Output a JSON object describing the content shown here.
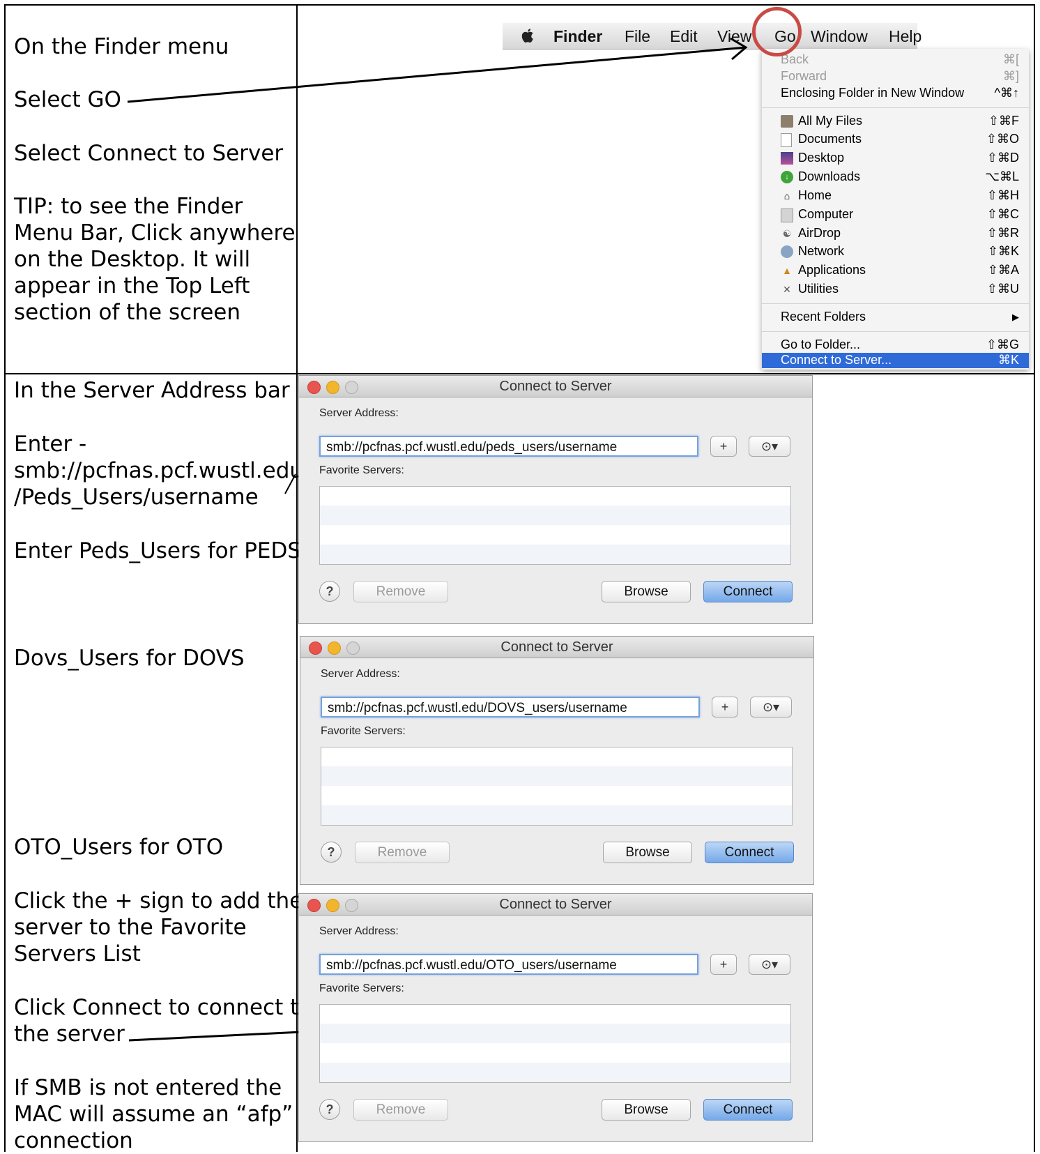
{
  "instructions_top": [
    "On the Finder menu",
    "Select GO",
    "Select Connect to Server",
    "TIP: to see the Finder",
    "Menu Bar, Click anywhere",
    "on the Desktop. It will",
    "appear in the Top Left",
    "section of the screen"
  ],
  "instructions_bottom": {
    "l1": "In the Server Address bar",
    "l2": "Enter -",
    "l3": "smb://pcfnas.pcf.wustl.edu",
    "l4": "/Peds_Users/username",
    "l5": "Enter Peds_Users for PEDS",
    "l6": "Dovs_Users for DOVS",
    "l7": "OTO_Users for OTO",
    "l8": "Click the + sign to add the",
    "l9": "server to the Favorite",
    "l10": "Servers List",
    "l11": "Click Connect to connect to",
    "l12": "the server",
    "l13": "If SMB is not entered the",
    "l14": "MAC will assume an “afp”",
    "l15": "connection"
  },
  "menubar": {
    "app": "Finder",
    "items": [
      "File",
      "Edit",
      "View",
      "Go",
      "Window",
      "Help"
    ]
  },
  "go_menu": [
    {
      "label": "Back",
      "shortcut": "⌘[",
      "disabled": true
    },
    {
      "label": "Forward",
      "shortcut": "⌘]",
      "disabled": true
    },
    {
      "label": "Enclosing Folder in New Window",
      "shortcut": "^⌘↑"
    },
    {
      "label": "All My Files",
      "shortcut": "⇧⌘F",
      "icon": "all-my-files-icon"
    },
    {
      "label": "Documents",
      "shortcut": "⇧⌘O",
      "icon": "documents-icon"
    },
    {
      "label": "Desktop",
      "shortcut": "⇧⌘D",
      "icon": "desktop-icon"
    },
    {
      "label": "Downloads",
      "shortcut": "⌥⌘L",
      "icon": "downloads-icon"
    },
    {
      "label": "Home",
      "shortcut": "⇧⌘H",
      "icon": "home-icon"
    },
    {
      "label": "Computer",
      "shortcut": "⇧⌘C",
      "icon": "computer-icon"
    },
    {
      "label": "AirDrop",
      "shortcut": "⇧⌘R",
      "icon": "airdrop-icon"
    },
    {
      "label": "Network",
      "shortcut": "⇧⌘K",
      "icon": "network-icon"
    },
    {
      "label": "Applications",
      "shortcut": "⇧⌘A",
      "icon": "applications-icon"
    },
    {
      "label": "Utilities",
      "shortcut": "⇧⌘U",
      "icon": "utilities-icon"
    },
    {
      "label": "Recent Folders",
      "shortcut": "▶"
    },
    {
      "label": "Go to Folder...",
      "shortcut": "⇧⌘G"
    },
    {
      "label": "Connect to Server...",
      "shortcut": "⌘K",
      "highlighted": true
    }
  ],
  "dialogs": [
    {
      "title": "Connect to Server",
      "address_label": "Server Address:",
      "address": "smb://pcfnas.pcf.wustl.edu/peds_users/username",
      "favorites_label": "Favorite Servers:",
      "help": "?",
      "remove": "Remove",
      "browse": "Browse",
      "connect": "Connect",
      "plus": "+",
      "history": "⊙▾"
    },
    {
      "title": "Connect to Server",
      "address_label": "Server Address:",
      "address": "smb://pcfnas.pcf.wustl.edu/DOVS_users/username",
      "favorites_label": "Favorite Servers:",
      "help": "?",
      "remove": "Remove",
      "browse": "Browse",
      "connect": "Connect",
      "plus": "+",
      "history": "⊙▾"
    },
    {
      "title": "Connect to Server",
      "address_label": "Server Address:",
      "address": "smb://pcfnas.pcf.wustl.edu/OTO_users/username",
      "favorites_label": "Favorite Servers:",
      "help": "?",
      "remove": "Remove",
      "browse": "Browse",
      "connect": "Connect",
      "plus": "+",
      "history": "⊙▾"
    }
  ],
  "colors": {
    "highlight": "#2f6bd8",
    "circle": "#c84b45",
    "connect_button": "#75a8e9"
  }
}
